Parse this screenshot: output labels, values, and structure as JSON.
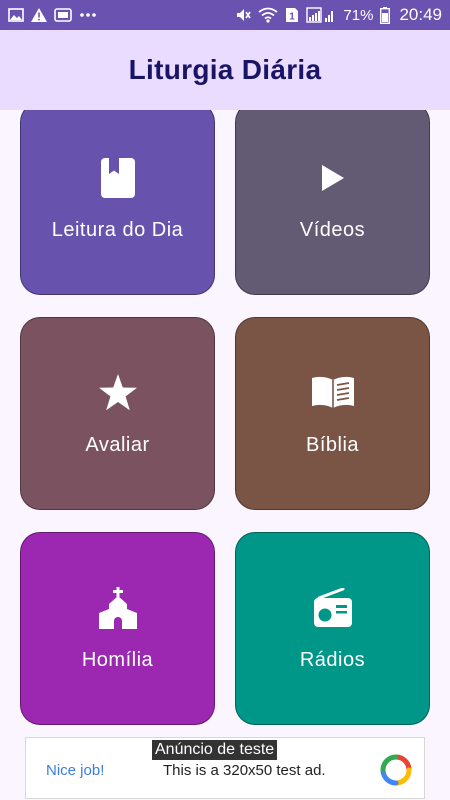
{
  "status_bar": {
    "battery_percent": "71%",
    "time": "20:49",
    "sim_badge": "1",
    "icons": [
      "gallery-icon",
      "warning-icon",
      "data-saver-icon",
      "more-dots-icon",
      "mute-icon",
      "wifi-icon",
      "sim-icon",
      "signal-icon",
      "battery-icon"
    ]
  },
  "app": {
    "title": "Liturgia Diária"
  },
  "tiles": [
    {
      "label": "Leitura do Dia",
      "icon": "book-icon",
      "color": "#6752ae"
    },
    {
      "label": "Vídeos",
      "icon": "play-icon",
      "color": "#635a74"
    },
    {
      "label": "Avaliar",
      "icon": "star-icon",
      "color": "#7b5360"
    },
    {
      "label": "Bíblia",
      "icon": "open-book-icon",
      "color": "#7a5546"
    },
    {
      "label": "Homília",
      "icon": "church-icon",
      "color": "#9c27b0"
    },
    {
      "label": "Rádios",
      "icon": "radio-icon",
      "color": "#009688"
    }
  ],
  "ad": {
    "tag": "Anúncio de teste",
    "nice": "Nice job!",
    "text": "This is a 320x50 test ad."
  }
}
